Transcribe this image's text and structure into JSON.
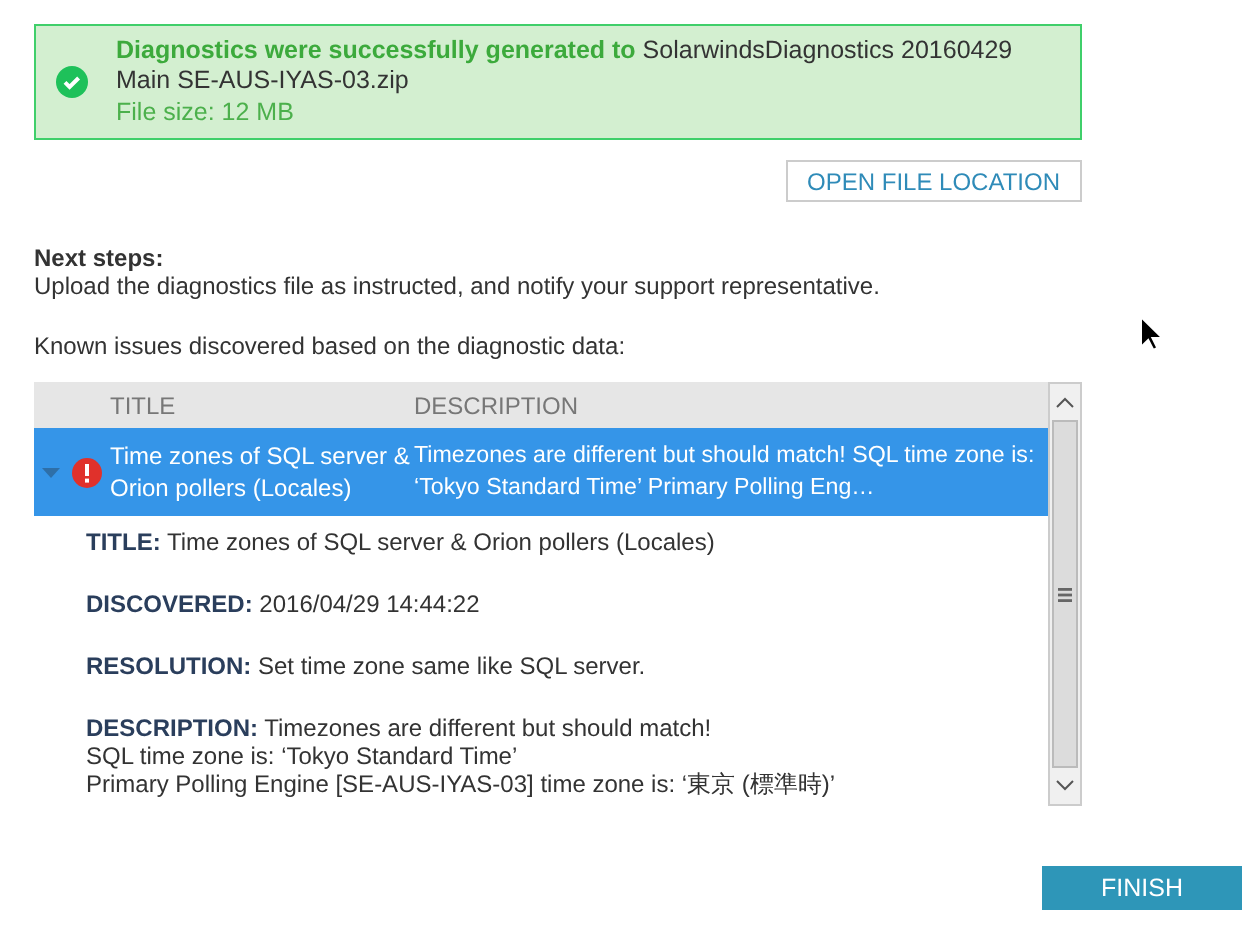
{
  "banner": {
    "kind": "success",
    "lead": "Diagnostics were successfully generated to",
    "file": "SolarwindsDiagnostics 20160429 Main SE-AUS-IYAS-03.zip",
    "size": "File size: 12 MB"
  },
  "open_button": "OPEN FILE LOCATION",
  "next_steps": {
    "heading": "Next steps:",
    "text": "Upload the diagnostics file as instructed, and notify your support representative."
  },
  "issues_intro": "Known issues discovered based on the diagnostic data:",
  "table": {
    "columns": [
      "TITLE",
      "DESCRIPTION"
    ],
    "rows": [
      {
        "kind": "error",
        "selected": true,
        "expanded": true,
        "title": "Time zones of SQL server & Orion pollers (Locales)",
        "description": "Timezones are different but should match! SQL time zone is: ‘Tokyo Standard Time’ Primary Polling Eng…",
        "details": [
          "**TITLE:** Time zones of SQL server & Orion pollers (Locales)",
          "**DISCOVERED:** 2016/04/29 14:44:22",
          "**RESOLUTION:** Set time zone same like SQL server.",
          "**DESCRIPTION:** Timezones are different but should match!"
        ],
        "description_lines": [
          "SQL time zone is: ‘Tokyo Standard Time’",
          "Primary Polling Engine [SE-AUS-IYAS-03] time zone is: ‘東京 (標準時)’"
        ]
      }
    ]
  },
  "finish_button": "FINISH"
}
